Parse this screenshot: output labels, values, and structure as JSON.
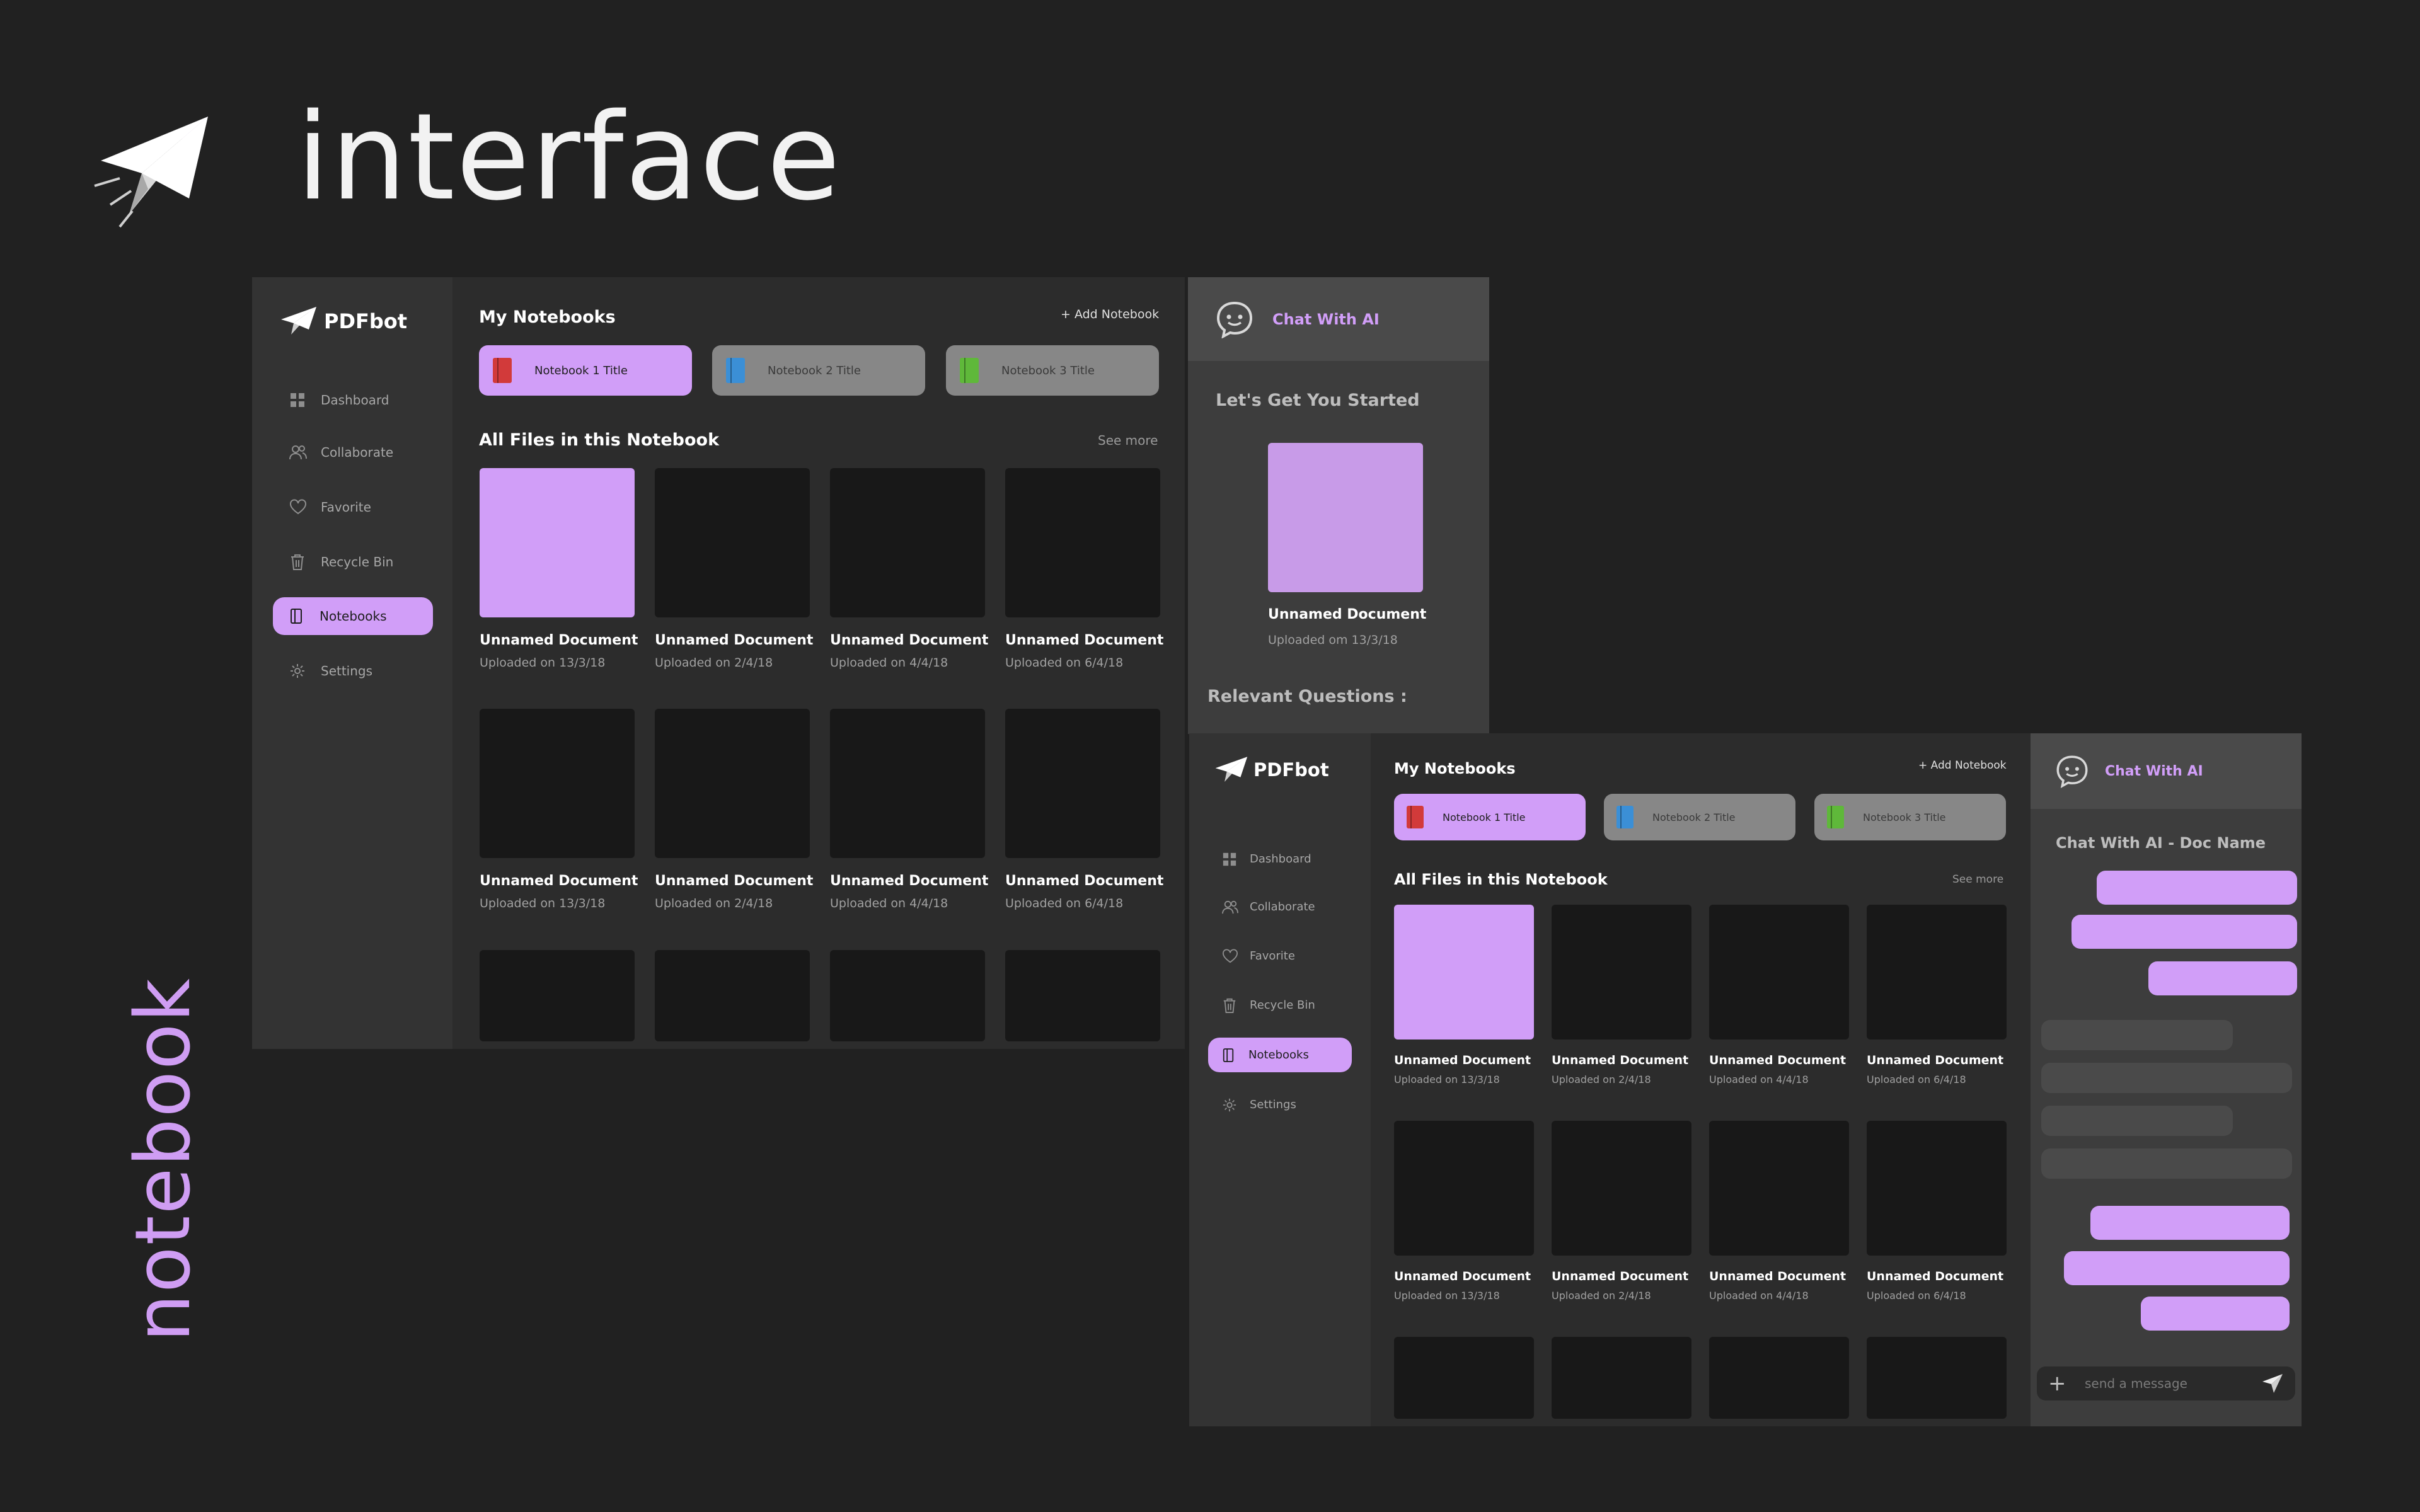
{
  "hero": {
    "title": "interface",
    "side_word": "notebook"
  },
  "colors": {
    "accent": "#d19ef8",
    "bg": "#212121",
    "panel": "#2c2c2c",
    "sidebar": "#333333",
    "thumb": "#181818",
    "book_red": "#d23a3a",
    "book_blue": "#3b8fd6",
    "book_green": "#5fb83a"
  },
  "brand": {
    "name": "PDFbot"
  },
  "nav": [
    {
      "label": "Dashboard",
      "icon": "grid-icon"
    },
    {
      "label": "Collaborate",
      "icon": "users-icon"
    },
    {
      "label": "Favorite",
      "icon": "heart-icon"
    },
    {
      "label": "Recycle Bin",
      "icon": "trash-icon"
    },
    {
      "label": "Notebooks",
      "icon": "notebook-icon",
      "active": true
    },
    {
      "label": "Settings",
      "icon": "gear-icon"
    }
  ],
  "notebooks": {
    "title": "My Notebooks",
    "add": "+ Add Notebook",
    "items": [
      "Notebook 1 Title",
      "Notebook 2 Title",
      "Notebook 3 Title"
    ]
  },
  "files": {
    "title": "All Files in this Notebook",
    "see_more": "See more",
    "docs": [
      {
        "name": "Unnamed Document",
        "date": "Uploaded on 13/3/18"
      },
      {
        "name": "Unnamed Document",
        "date": "Uploaded on 2/4/18"
      },
      {
        "name": "Unnamed Document",
        "date": "Uploaded on 4/4/18"
      },
      {
        "name": "Unnamed Document",
        "date": "Uploaded on 6/4/18"
      }
    ]
  },
  "chat1": {
    "title": "Chat With AI",
    "started": "Let's Get You Started",
    "doc_name": "Unnamed Document",
    "doc_date": "Uploaded om 13/3/18",
    "relevant": "Relevant Questions :"
  },
  "chat2": {
    "title": "Chat With AI",
    "subtitle": "Chat With AI - Doc Name",
    "input_placeholder": "send a message"
  }
}
